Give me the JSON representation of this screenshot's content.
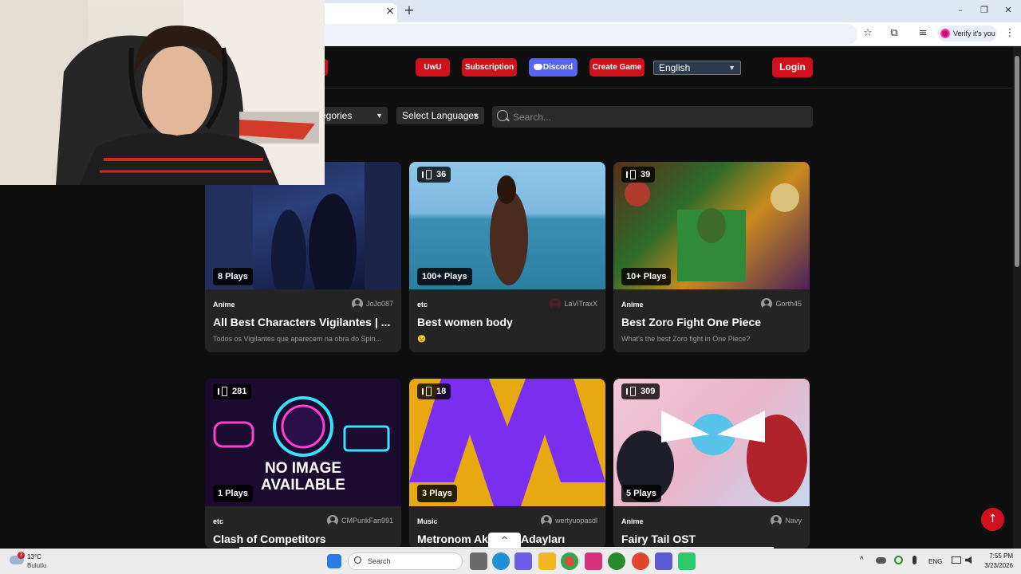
{
  "browser": {
    "new_tab_glyph": "+",
    "close_tab_glyph": "×",
    "verify_label": "Verify it's you",
    "window_controls": [
      "–",
      "❐",
      "✕"
    ]
  },
  "header": {
    "nav": [
      {
        "label": "UwU"
      },
      {
        "label": "Subscription"
      },
      {
        "label": "Discord"
      },
      {
        "label": "Create Game"
      }
    ],
    "language": "English",
    "login_label": "Login"
  },
  "filters": {
    "categories_label": "egories",
    "languages_label": "Select Languages",
    "search_placeholder": "Search..."
  },
  "cards": [
    {
      "questions": "",
      "plays": "8 Plays",
      "category": "Anime",
      "author": "JoJo087",
      "title": "All Best Characters Vigilantes | ...",
      "description": "Todos os Vigilantes que aparecem na obra do Spin..."
    },
    {
      "questions": "36",
      "plays": "100+ Plays",
      "category": "etc",
      "author": "LaViTraxX",
      "title": "Best women body",
      "description": "😉"
    },
    {
      "questions": "39",
      "plays": "10+ Plays",
      "category": "Anime",
      "author": "Gorth45",
      "title": "Best Zoro Fight One Piece",
      "description": "What's the best Zoro fight in One Piece?"
    },
    {
      "questions": "281",
      "plays": "1 Plays",
      "category": "etc",
      "author": "CMPunkFan991",
      "title": "Clash of Competitors",
      "description": ""
    },
    {
      "questions": "18",
      "plays": "3 Plays",
      "category": "Music",
      "author": "wertyuopasdl",
      "title": "Metronom Aka",
      "title_tail": "Adayları",
      "description": ""
    },
    {
      "questions": "309",
      "plays": "5 Plays",
      "category": "Anime",
      "author": "Navy",
      "title": "Fairy Tail OST",
      "description": ""
    }
  ],
  "no_image_text": [
    "NO IMAGE",
    "AVAILABLE"
  ],
  "to_top_glyph": "↑",
  "collapse_glyph": "^",
  "taskbar": {
    "weather_temp": "13°C",
    "weather_desc": "Bulutlu",
    "weather_badge": "3",
    "search_label": "Search",
    "lang": "ENG",
    "time": "7:55 PM",
    "date": "3/23/2026"
  }
}
